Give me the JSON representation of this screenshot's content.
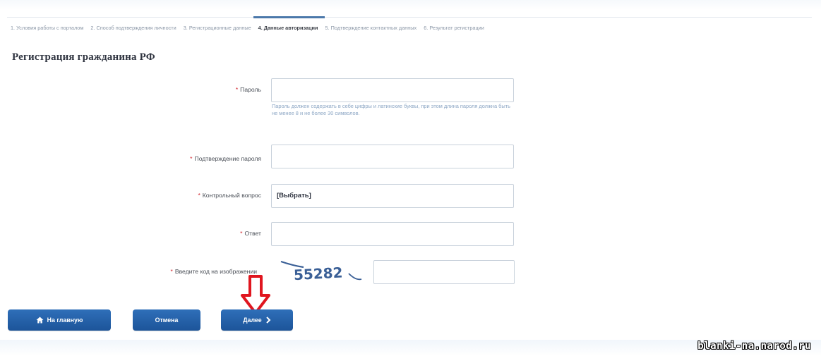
{
  "steps": [
    {
      "label": "1. Условия работы с порталом",
      "active": false
    },
    {
      "label": "2. Способ подтверждения личности",
      "active": false
    },
    {
      "label": "3. Регистрационные данные",
      "active": false
    },
    {
      "label": "4. Данные авторизации",
      "active": true
    },
    {
      "label": "5. Подтверждение контактных данных",
      "active": false
    },
    {
      "label": "6. Результат регистрации",
      "active": false
    }
  ],
  "page_title": "Регистрация гражданина РФ",
  "required_marker": "*",
  "form": {
    "password": {
      "label": "Пароль",
      "value": ""
    },
    "password_hint": "Пароль должен содержать в себе цифры и латинские буквы, при этом длина пароля должна быть не менее 8 и не более 30 символов.",
    "password_confirm": {
      "label": "Подтверждение пароля",
      "value": ""
    },
    "security_question": {
      "label": "Контрольный вопрос",
      "selected": "[Выбрать]"
    },
    "answer": {
      "label": "Ответ",
      "value": ""
    },
    "captcha": {
      "label": "Введите код на изображении",
      "image_text": "55282",
      "value": ""
    }
  },
  "buttons": {
    "home": "На главную",
    "cancel": "Отмена",
    "next": "Далее"
  },
  "icons": {
    "home": "home-icon",
    "next": "chevron-right-icon",
    "marker": "down-arrow-icon"
  },
  "colors": {
    "button": "#1c5499",
    "required": "#d0232b",
    "marker": "#e0161f",
    "active_step": "#4b78aa"
  },
  "watermark": "blanki-na.narod.ru"
}
